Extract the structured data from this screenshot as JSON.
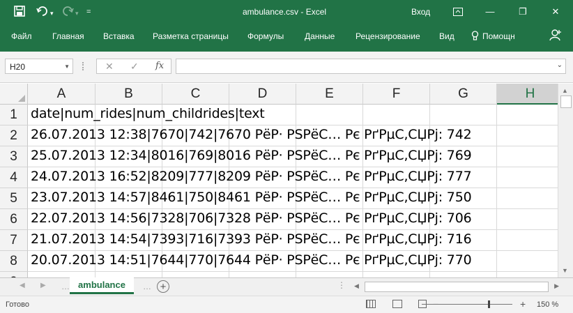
{
  "window": {
    "title": "ambulance.csv  -  Excel",
    "signin": "Вход",
    "minimize": "—",
    "restore": "❐",
    "close": "✕"
  },
  "quick_access": {
    "save_icon": "save-icon",
    "undo_icon": "undo-icon",
    "redo_icon": "redo-icon",
    "customize": "="
  },
  "ribbon_tabs": [
    "Файл",
    "Главная",
    "Вставка",
    "Разметка страницы",
    "Формулы",
    "Данные",
    "Рецензирование",
    "Вид",
    "Помощн"
  ],
  "formula_bar": {
    "name_box": "H20",
    "cancel": "✕",
    "enter": "✓",
    "fx": "fx",
    "formula": ""
  },
  "columns": [
    "A",
    "B",
    "C",
    "D",
    "E",
    "F",
    "G",
    "H"
  ],
  "selected_column": "H",
  "rows": [
    {
      "n": "1",
      "text": "date|num_rides|num_childrides|text"
    },
    {
      "n": "2",
      "text": "26.07.2013 12:38|7670|742|7670 РёР· PSPёС… Рє РґРµС‚СЏРј: 742"
    },
    {
      "n": "3",
      "text": "25.07.2013 12:34|8016|769|8016 РёР· PSPёС… Рє РґРµС‚СЏРј: 769"
    },
    {
      "n": "4",
      "text": "24.07.2013 16:52|8209|777|8209 РёР· PSPёС… Рє РґРµС‚СЏРј: 777"
    },
    {
      "n": "5",
      "text": "23.07.2013 14:57|8461|750|8461 РёР· PSPёС… Рє РґРµС‚СЏРј: 750"
    },
    {
      "n": "6",
      "text": "22.07.2013 14:56|7328|706|7328 РёР· PSPёС… Рє РґРµС‚СЏРј: 706"
    },
    {
      "n": "7",
      "text": "21.07.2013 14:54|7393|716|7393 РёР· PSPёС… Рє РґРµС‚СЏРј: 716"
    },
    {
      "n": "8",
      "text": "20.07.2013 14:51|7644|770|7644 РёР· PSPёС… Рє РґРµС‚СЏРј: 770"
    }
  ],
  "sheet_tabs": [
    {
      "label": "ambulance",
      "active": true
    }
  ],
  "status": {
    "ready": "Готово",
    "zoom": "150 %",
    "zoom_out": "−",
    "zoom_in": "+"
  },
  "colors": {
    "accent": "#217346"
  }
}
